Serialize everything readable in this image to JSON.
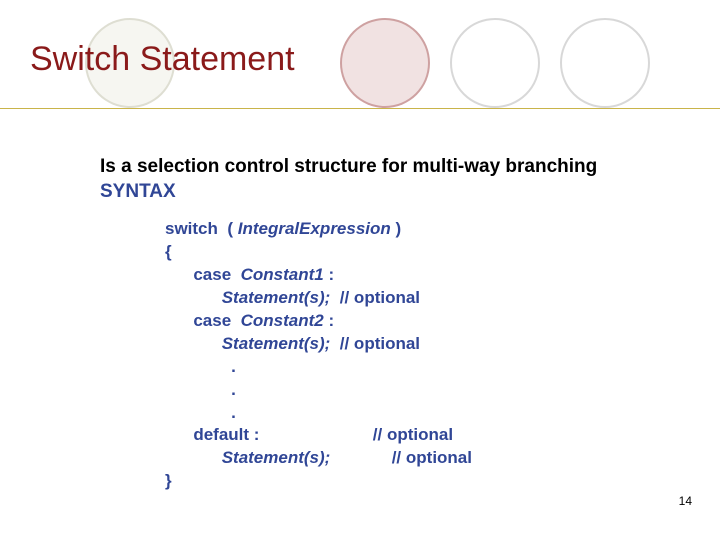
{
  "title": "Switch Statement",
  "intro_line": "Is a selection control structure for multi-way branching",
  "syntax_label": "SYNTAX",
  "code": {
    "l1a": "switch  ( ",
    "l1b": "IntegralExpression",
    "l1c": " )",
    "l2": "{",
    "l3a": "      case  ",
    "l3b": "Constant1",
    "l3c": " :",
    "l4a": "            ",
    "l4b": "Statement(s);",
    "l4c": "  // optional",
    "l5a": "      case  ",
    "l5b": "Constant2",
    "l5c": " :",
    "l6a": "            ",
    "l6b": "Statement(s);",
    "l6c": "  // optional",
    "l7": "              .",
    "l8": "              .",
    "l9": "              .",
    "l10a": "      default :",
    "l10b": "                        // optional",
    "l11a": "            ",
    "l11b": "Statement(s);",
    "l11c": "             // optional",
    "l12": "}"
  },
  "page_number": "14"
}
